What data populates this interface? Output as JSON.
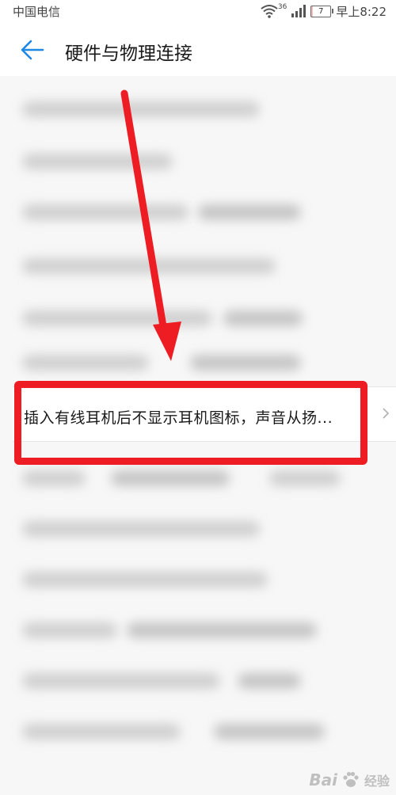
{
  "status_bar": {
    "carrier": "中国电信",
    "network": "36",
    "battery": "7",
    "time": "早上8:22"
  },
  "header": {
    "title": "硬件与物理连接"
  },
  "highlighted_item": {
    "label": "插入有线耳机后不显示耳机图标，声音从扬..."
  },
  "watermark": {
    "text": "Bai",
    "text2": "经验"
  },
  "colors": {
    "accent": "#1e88e5",
    "annotation_red": "#ee1c23"
  }
}
